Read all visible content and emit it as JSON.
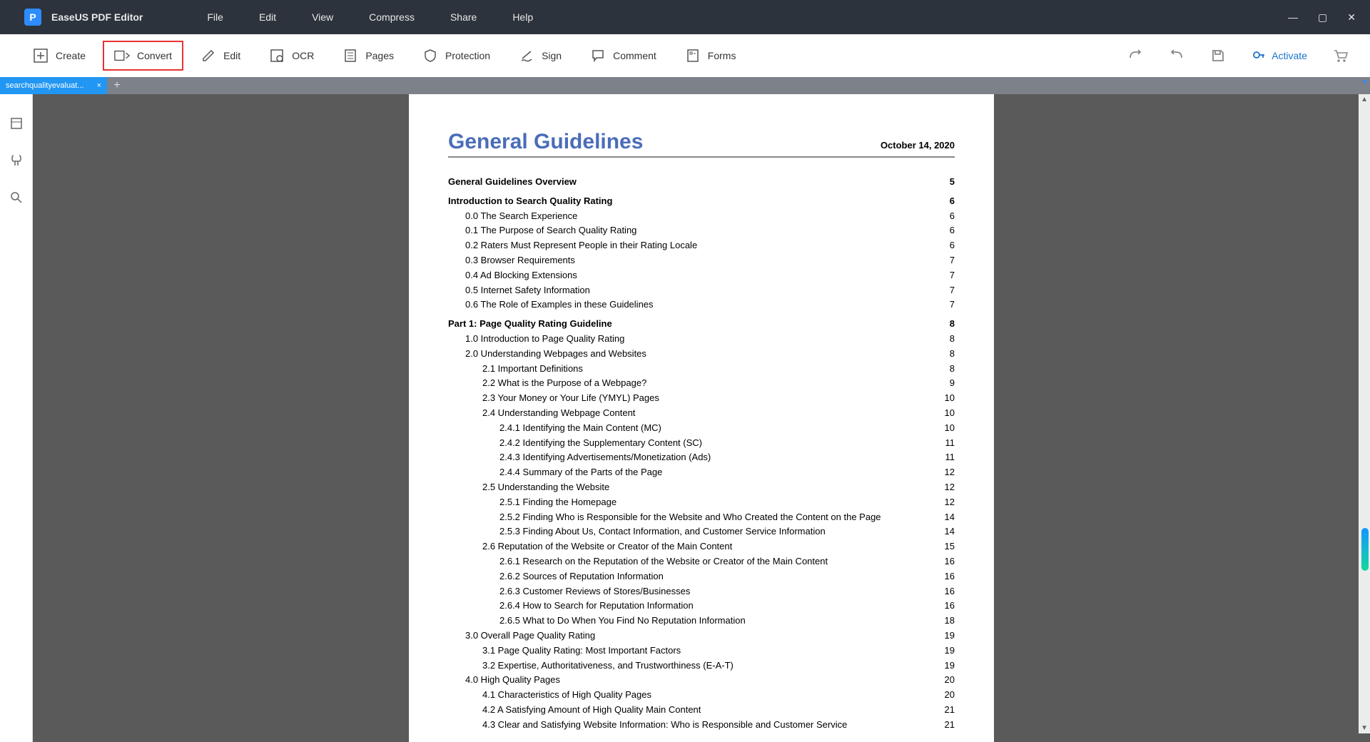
{
  "app": {
    "name": "EaseUS PDF Editor"
  },
  "menu": {
    "file": "File",
    "edit": "Edit",
    "view": "View",
    "compress": "Compress",
    "share": "Share",
    "help": "Help"
  },
  "toolbar": {
    "create": "Create",
    "convert": "Convert",
    "edit": "Edit",
    "ocr": "OCR",
    "pages": "Pages",
    "protection": "Protection",
    "sign": "Sign",
    "comment": "Comment",
    "forms": "Forms",
    "activate": "Activate"
  },
  "tab": {
    "filename": "searchqualityevaluat..."
  },
  "doc": {
    "title": "General Guidelines",
    "date": "October 14, 2020",
    "toc": [
      {
        "t": "General Guidelines Overview",
        "p": "5",
        "b": true,
        "i": 0
      },
      {
        "t": "Introduction to Search Quality Rating",
        "p": "6",
        "b": true,
        "i": 0
      },
      {
        "t": "0.0 The Search Experience",
        "p": "6",
        "i": 1
      },
      {
        "t": "0.1 The Purpose of Search Quality Rating",
        "p": "6",
        "i": 1
      },
      {
        "t": "0.2 Raters Must Represent People in their Rating Locale",
        "p": "6",
        "i": 1
      },
      {
        "t": "0.3 Browser Requirements",
        "p": "7",
        "i": 1
      },
      {
        "t": "0.4 Ad Blocking Extensions",
        "p": "7",
        "i": 1
      },
      {
        "t": "0.5 Internet Safety Information",
        "p": "7",
        "i": 1
      },
      {
        "t": "0.6 The Role of Examples in these Guidelines",
        "p": "7",
        "i": 1
      },
      {
        "t": "Part 1: Page Quality Rating Guideline",
        "p": "8",
        "b": true,
        "i": 0
      },
      {
        "t": "1.0 Introduction to Page Quality Rating",
        "p": "8",
        "i": 1
      },
      {
        "t": "2.0 Understanding Webpages and Websites",
        "p": "8",
        "i": 1
      },
      {
        "t": "2.1 Important Definitions",
        "p": "8",
        "i": 2
      },
      {
        "t": "2.2 What is the Purpose of a Webpage?",
        "p": "9",
        "i": 2
      },
      {
        "t": "2.3 Your Money or Your Life (YMYL) Pages",
        "p": "10",
        "i": 2
      },
      {
        "t": "2.4 Understanding Webpage Content",
        "p": "10",
        "i": 2
      },
      {
        "t": "2.4.1 Identifying the Main Content (MC)",
        "p": "10",
        "i": 3
      },
      {
        "t": "2.4.2 Identifying the Supplementary Content (SC)",
        "p": "11",
        "i": 3
      },
      {
        "t": "2.4.3 Identifying Advertisements/Monetization (Ads)",
        "p": "11",
        "i": 3
      },
      {
        "t": "2.4.4 Summary of the Parts of the Page",
        "p": "12",
        "i": 3
      },
      {
        "t": "2.5 Understanding the Website",
        "p": "12",
        "i": 2
      },
      {
        "t": "2.5.1 Finding the Homepage",
        "p": "12",
        "i": 3
      },
      {
        "t": "2.5.2 Finding Who is Responsible for the Website and Who Created the Content on the Page",
        "p": "14",
        "i": 3
      },
      {
        "t": "2.5.3 Finding About Us, Contact Information, and Customer Service Information",
        "p": "14",
        "i": 3
      },
      {
        "t": "2.6 Reputation of the Website or Creator of the Main Content",
        "p": "15",
        "i": 2
      },
      {
        "t": "2.6.1 Research on the Reputation of the Website or Creator of the Main Content",
        "p": "16",
        "i": 3
      },
      {
        "t": "2.6.2 Sources of Reputation Information",
        "p": "16",
        "i": 3
      },
      {
        "t": "2.6.3 Customer Reviews of Stores/Businesses",
        "p": "16",
        "i": 3
      },
      {
        "t": "2.6.4 How to Search for Reputation Information",
        "p": "16",
        "i": 3
      },
      {
        "t": "2.6.5 What to Do When You Find No Reputation Information",
        "p": "18",
        "i": 3
      },
      {
        "t": "3.0 Overall Page Quality Rating",
        "p": "19",
        "i": 1
      },
      {
        "t": "3.1 Page Quality Rating: Most Important Factors",
        "p": "19",
        "i": 2
      },
      {
        "t": "3.2 Expertise, Authoritativeness, and Trustworthiness (E-A-T)",
        "p": "19",
        "i": 2
      },
      {
        "t": "4.0 High Quality Pages",
        "p": "20",
        "i": 1
      },
      {
        "t": "4.1 Characteristics of High Quality Pages",
        "p": "20",
        "i": 2
      },
      {
        "t": "4.2 A Satisfying Amount of High Quality Main Content",
        "p": "21",
        "i": 2
      },
      {
        "t": "4.3 Clear and Satisfying Website Information: Who is Responsible and Customer Service",
        "p": "21",
        "i": 2
      }
    ]
  }
}
